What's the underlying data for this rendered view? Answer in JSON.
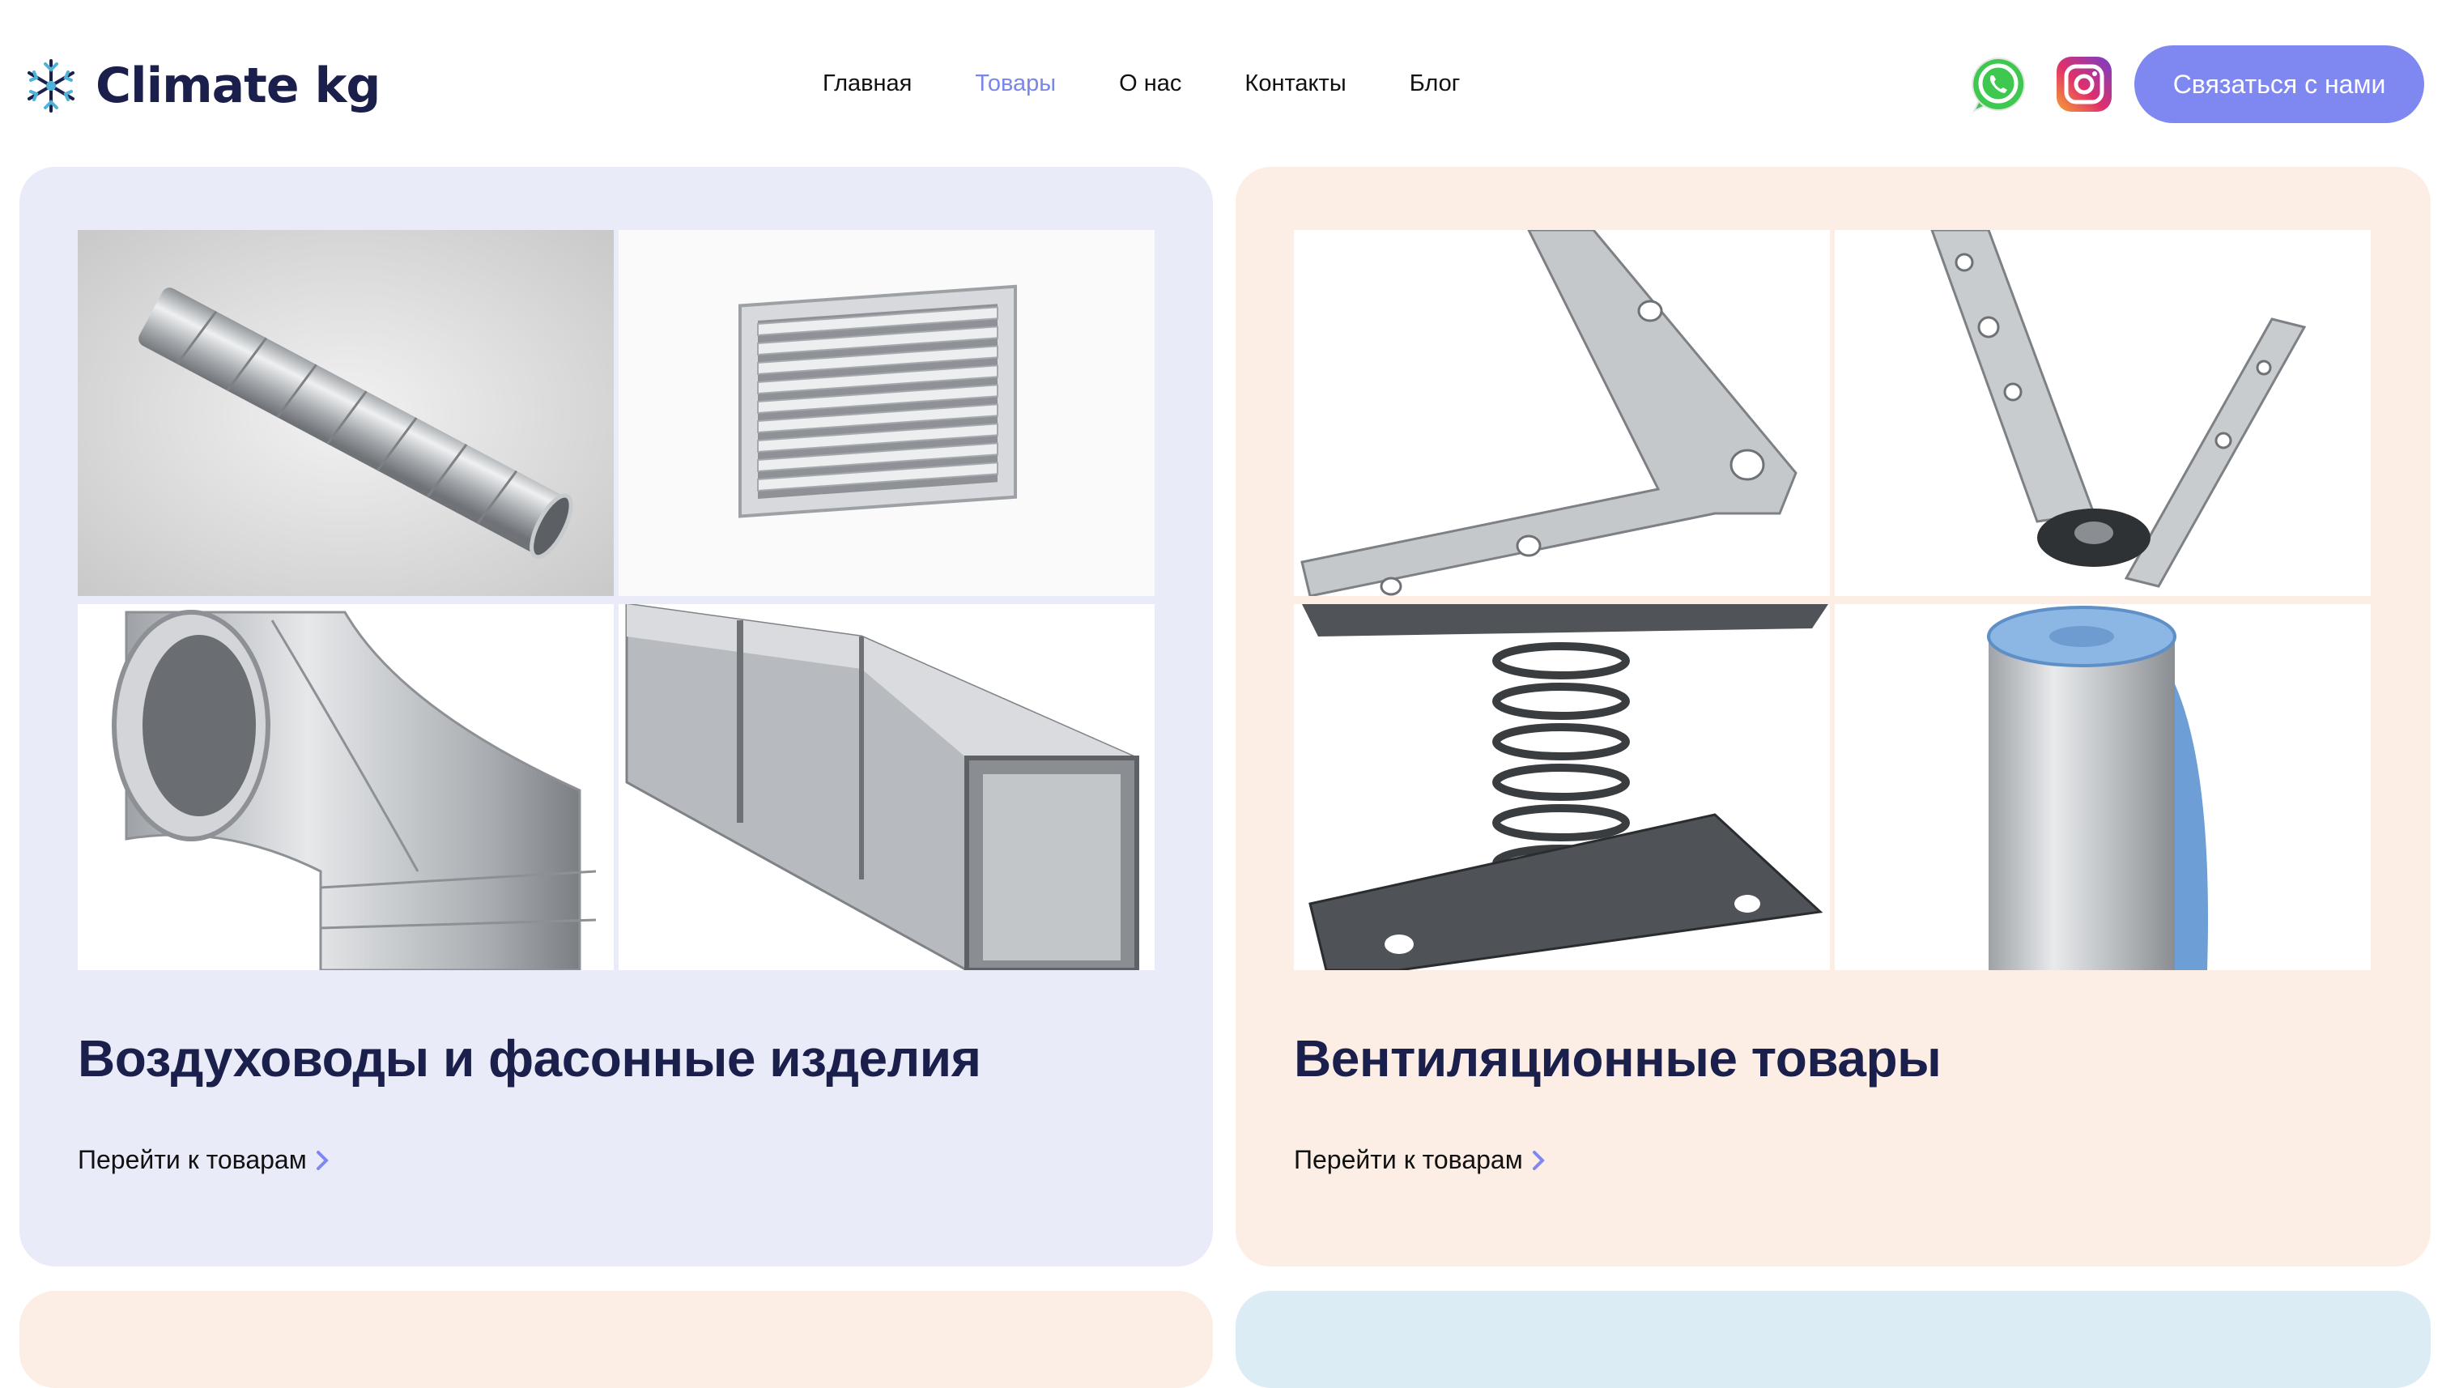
{
  "brand": {
    "name": "Climate kg"
  },
  "nav": {
    "items": [
      {
        "label": "Главная",
        "active": false
      },
      {
        "label": "Товары",
        "active": true
      },
      {
        "label": "О нас",
        "active": false
      },
      {
        "label": "Контакты",
        "active": false
      },
      {
        "label": "Блог",
        "active": false
      }
    ]
  },
  "header": {
    "social_icons": [
      "whatsapp-icon",
      "instagram-icon"
    ],
    "cta_label": "Связаться с нами"
  },
  "categories": [
    {
      "title": "Воздуховоды и фасонные изделия",
      "link_label": "Перейти к товарам",
      "images": [
        "spiral-duct-image",
        "air-grille-image",
        "duct-elbow-image",
        "rectangular-duct-image"
      ]
    },
    {
      "title": "Вентиляционные товары",
      "link_label": "Перейти к товарам",
      "images": [
        "mounting-bracket-image",
        "hanger-bracket-image",
        "spring-damper-image",
        "foil-insulation-roll-image"
      ]
    }
  ],
  "colors": {
    "accent": "#7e88f0",
    "nav_active": "#7a86e8",
    "heading": "#1b1f4b",
    "card_lavender": "#e9ebf9",
    "card_peach": "#fcede5",
    "card_blue": "#dbecf5"
  }
}
